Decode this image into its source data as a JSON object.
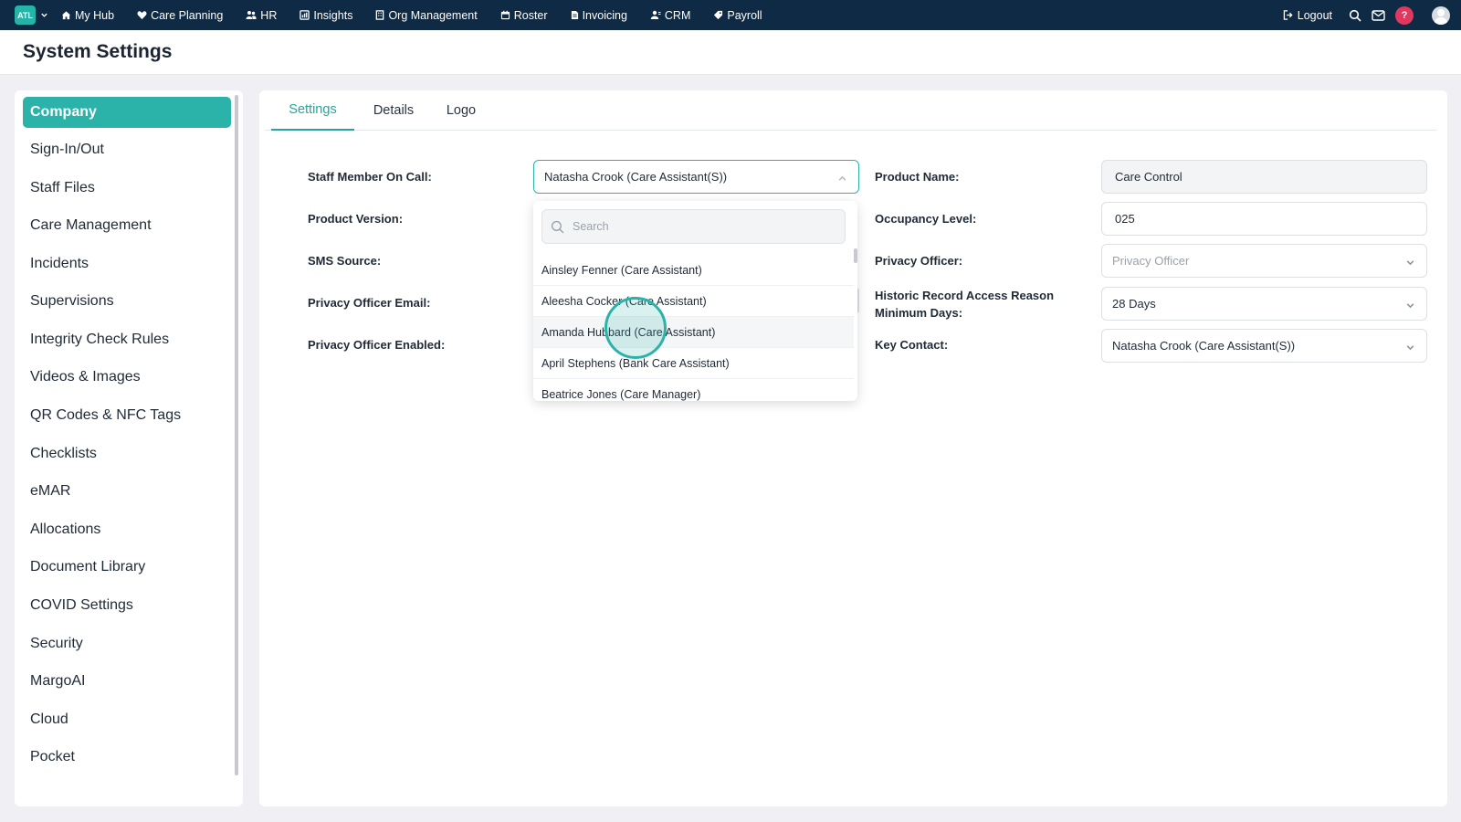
{
  "topnav": {
    "logo_text": "ATL",
    "items": [
      {
        "label": "My Hub",
        "icon": "home-icon"
      },
      {
        "label": "Care Planning",
        "icon": "heart-icon"
      },
      {
        "label": "HR",
        "icon": "users-icon"
      },
      {
        "label": "Insights",
        "icon": "chart-icon"
      },
      {
        "label": "Org Management",
        "icon": "building-icon"
      },
      {
        "label": "Roster",
        "icon": "calendar-icon"
      },
      {
        "label": "Invoicing",
        "icon": "document-icon"
      },
      {
        "label": "CRM",
        "icon": "contacts-icon"
      },
      {
        "label": "Payroll",
        "icon": "tag-icon"
      }
    ],
    "logout_label": "Logout",
    "help_label": "?"
  },
  "page": {
    "title": "System Settings"
  },
  "sidebar": {
    "items": [
      {
        "label": "Company",
        "active": true
      },
      {
        "label": "Sign-In/Out"
      },
      {
        "label": "Staff Files"
      },
      {
        "label": "Care Management"
      },
      {
        "label": "Incidents"
      },
      {
        "label": "Supervisions"
      },
      {
        "label": "Integrity Check Rules"
      },
      {
        "label": "Videos & Images"
      },
      {
        "label": "QR Codes & NFC Tags"
      },
      {
        "label": "Checklists"
      },
      {
        "label": "eMAR"
      },
      {
        "label": "Allocations"
      },
      {
        "label": "Document Library"
      },
      {
        "label": "COVID Settings"
      },
      {
        "label": "Security"
      },
      {
        "label": "MargoAI"
      },
      {
        "label": "Cloud"
      },
      {
        "label": "Pocket"
      }
    ]
  },
  "tabs": [
    {
      "label": "Settings",
      "active": true
    },
    {
      "label": "Details"
    },
    {
      "label": "Logo"
    }
  ],
  "form": {
    "left_labels": {
      "staff_on_call": "Staff Member On Call:",
      "product_version": "Product Version:",
      "sms_source": "SMS Source:",
      "privacy_officer_email": "Privacy Officer Email:",
      "privacy_officer_enabled": "Privacy Officer Enabled:"
    },
    "staff_on_call_value": "Natasha Crook (Care Assistant(S))",
    "right": {
      "product_name_label": "Product Name:",
      "product_name_value": "Care Control",
      "occupancy_label": "Occupancy Level:",
      "occupancy_value": "025",
      "privacy_officer_label": "Privacy Officer:",
      "privacy_officer_placeholder": "Privacy Officer",
      "historic_label_line1": "Historic Record Access Reason",
      "historic_label_line2": "Minimum Days:",
      "historic_value": "28 Days",
      "key_contact_label": "Key Contact:",
      "key_contact_value": "Natasha Crook (Care Assistant(S))"
    }
  },
  "dropdown": {
    "search_placeholder": "Search",
    "options": [
      "Ainsley Fenner (Care Assistant)",
      "Aleesha Cocker (Care Assistant)",
      "Amanda Hubbard (Care Assistant)",
      "April Stephens (Bank Care Assistant)",
      "Beatrice Jones (Care Manager)"
    ]
  },
  "colors": {
    "nav_bg": "#0f2a44",
    "accent": "#2bb3a9",
    "help_badge": "#e0385f"
  }
}
